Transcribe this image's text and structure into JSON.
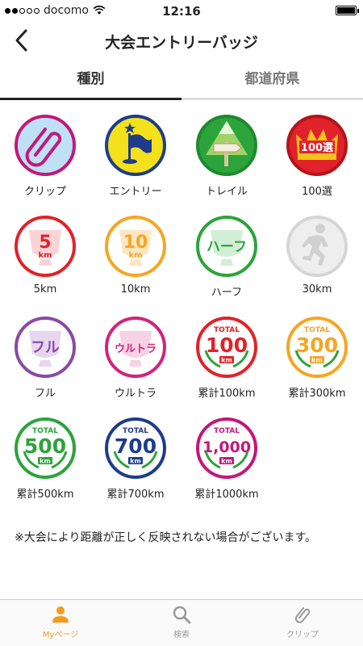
{
  "status": {
    "carrier": "docomo",
    "time": "12:16"
  },
  "nav": {
    "title": "大会エントリーバッジ"
  },
  "tabs": [
    {
      "label": "種別"
    },
    {
      "label": "都道府県"
    }
  ],
  "badges": [
    {
      "label": "クリップ"
    },
    {
      "label": "エントリー"
    },
    {
      "label": "トレイル"
    },
    {
      "label": "100選",
      "text": "100選"
    },
    {
      "label": "5km",
      "text": "5",
      "unit": "km"
    },
    {
      "label": "10km",
      "text": "10",
      "unit": "km"
    },
    {
      "label": "ハーフ",
      "text": "ハーフ"
    },
    {
      "label": "30km"
    },
    {
      "label": "フル",
      "text": "フル"
    },
    {
      "label": "ウルトラ",
      "text": "ウルトラ"
    },
    {
      "label": "累計100km",
      "top": "TOTAL",
      "text": "100",
      "unit": "km"
    },
    {
      "label": "累計300km",
      "top": "TOTAL",
      "text": "300",
      "unit": "km"
    },
    {
      "label": "累計500km",
      "top": "TOTAL",
      "text": "500",
      "unit": "km"
    },
    {
      "label": "累計700km",
      "top": "TOTAL",
      "text": "700",
      "unit": "km"
    },
    {
      "label": "累計1000km",
      "top": "TOTAL",
      "text": "1,000",
      "unit": "km"
    }
  ],
  "note": "※大会により距離が正しく反映されない場合がございます。",
  "bottom_nav": [
    {
      "label": "Myページ"
    },
    {
      "label": "検索"
    },
    {
      "label": "クリップ"
    }
  ],
  "colors": {
    "accent": "#f39a1e",
    "red": "#e1222a",
    "orange": "#f5a623",
    "green": "#2ca43b",
    "navy": "#1d3c8c",
    "magenta": "#c2187a",
    "purple": "#8a4aa6"
  }
}
